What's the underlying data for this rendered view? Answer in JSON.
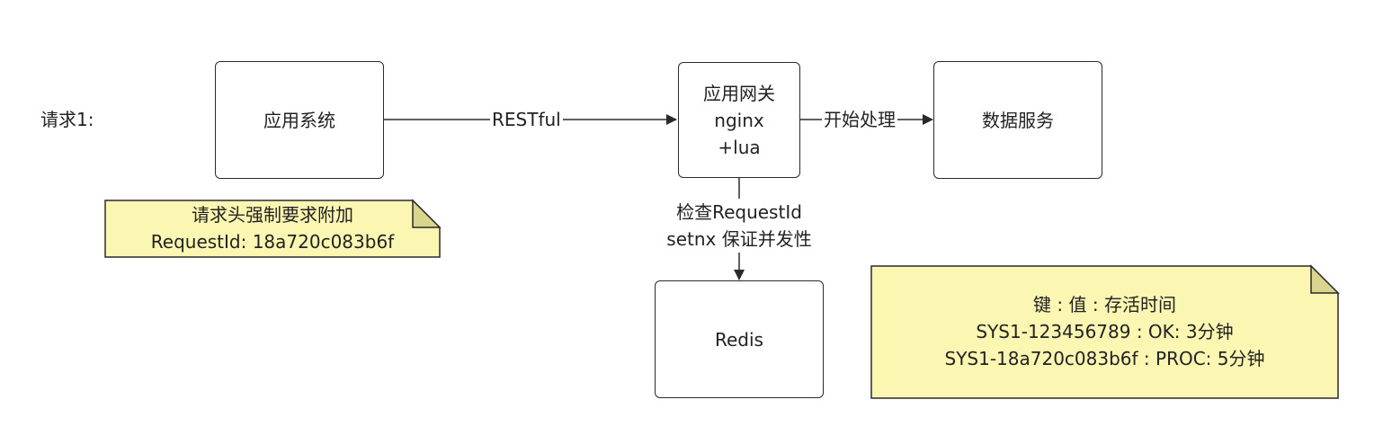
{
  "request_label": "请求1:",
  "nodes": {
    "app_system": "应用系统",
    "gateway": [
      "应用网关",
      "nginx",
      "+lua"
    ],
    "data_service": "数据服务",
    "redis": "Redis"
  },
  "edges": {
    "restful": "RESTful",
    "start_processing": "开始处理",
    "check": [
      "检查RequestId",
      "setnx 保证并发性"
    ]
  },
  "notes": {
    "request_header": [
      "请求头强制要求附加",
      "RequestId: 18a720c083b6f"
    ],
    "redis_keys": [
      "键 : 值 : 存活时间",
      "SYS1-123456789 : OK: 3分钟",
      "SYS1-18a720c083b6f : PROC: 5分钟"
    ]
  },
  "colors": {
    "note_fill": "#fbf7b3",
    "note_fold": "#d9d58f",
    "stroke": "#2a2a2a"
  }
}
